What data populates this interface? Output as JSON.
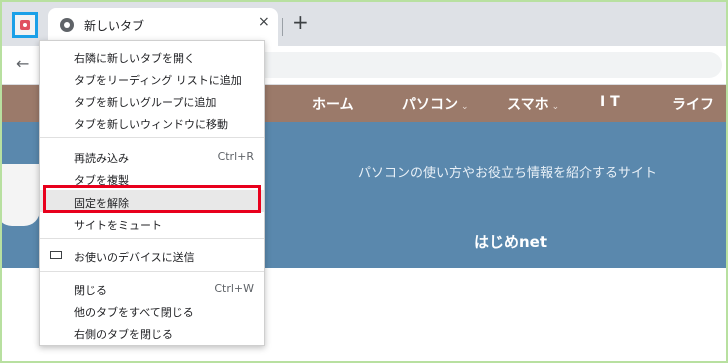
{
  "browser": {
    "active_tab_title": "新しいタブ",
    "close_glyph": "×",
    "new_tab_glyph": "+",
    "back_glyph": "←"
  },
  "site": {
    "nav": [
      "ホーム",
      "パソコン",
      "スマホ",
      "I T",
      "ライフ"
    ],
    "tagline": "パソコンの使い方やお役立ち情報を紹介するサイト",
    "name": "はじめnet"
  },
  "menu": {
    "items": [
      {
        "label": "右隣に新しいタブを開く",
        "shortcut": ""
      },
      {
        "label": "タブをリーディング リストに追加",
        "shortcut": ""
      },
      {
        "label": "タブを新しいグループに追加",
        "shortcut": ""
      },
      {
        "label": "タブを新しいウィンドウに移動",
        "shortcut": ""
      },
      {
        "label": "再読み込み",
        "shortcut": "Ctrl+R"
      },
      {
        "label": "タブを複製",
        "shortcut": ""
      },
      {
        "label": "固定を解除",
        "shortcut": ""
      },
      {
        "label": "サイトをミュート",
        "shortcut": ""
      },
      {
        "label": "お使いのデバイスに送信",
        "shortcut": ""
      },
      {
        "label": "閉じる",
        "shortcut": "Ctrl+W"
      },
      {
        "label": "他のタブをすべて閉じる",
        "shortcut": ""
      },
      {
        "label": "右側のタブを閉じる",
        "shortcut": ""
      }
    ]
  },
  "colors": {
    "highlight_border": "#e8001c",
    "pinned_tab_border": "#1aa0e8",
    "navbar": "#9b7a6a",
    "hero": "#5a88ad"
  }
}
